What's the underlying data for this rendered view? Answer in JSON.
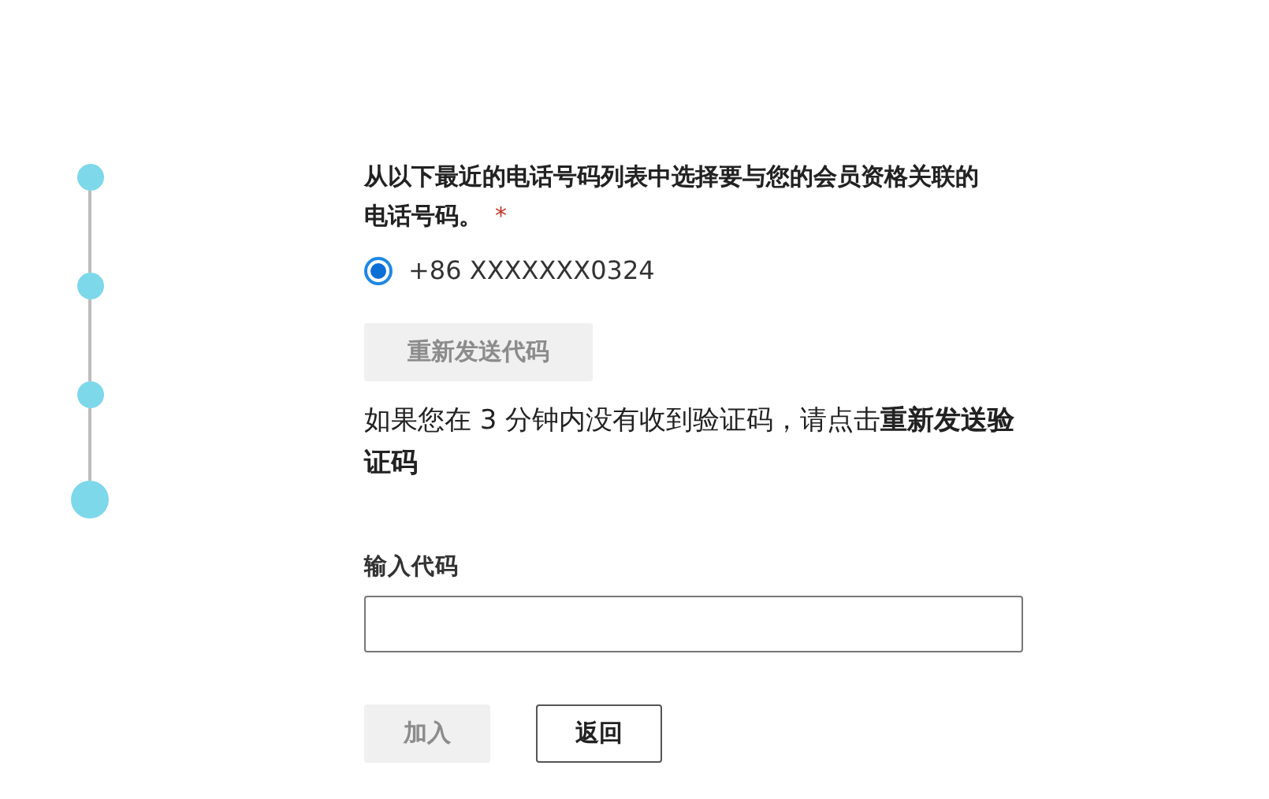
{
  "steps": [
    {
      "current": false
    },
    {
      "current": false
    },
    {
      "current": false
    },
    {
      "current": true
    }
  ],
  "prompt": {
    "text": "从以下最近的电话号码列表中选择要与您的会员资格关联的电话号码。",
    "required_mark": "*"
  },
  "phones": [
    {
      "label": "+86 XXXXXXX0324",
      "selected": true
    }
  ],
  "resend_button": {
    "label": "重新发送代码",
    "disabled": true
  },
  "hint": "如果您在 3 分钟内没有收到验证码，请点击**重新发送验证码**",
  "code_field": {
    "label": "输入代码"
  },
  "buttons": [
    {
      "label": "加入",
      "disabled": true
    },
    {
      "label": "返回",
      "disabled": false
    }
  ]
}
